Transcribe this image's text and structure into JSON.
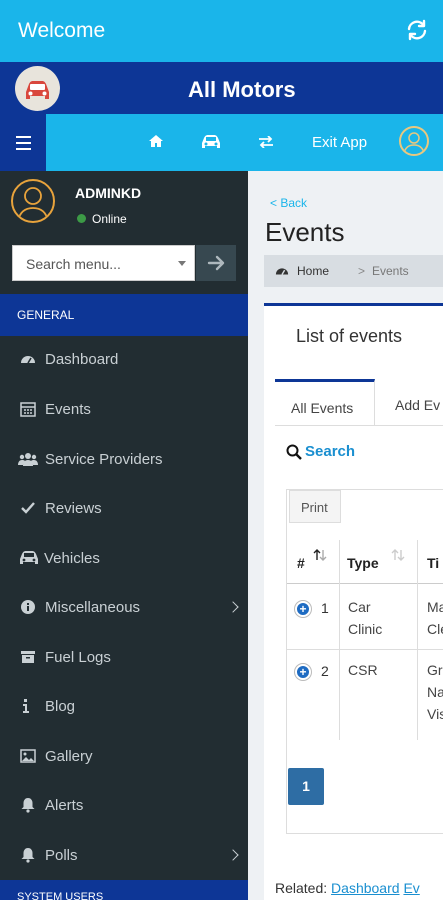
{
  "appbar": {
    "title": "Welcome",
    "refresh_icon": "refresh-icon"
  },
  "brand": {
    "name": "All Motors",
    "logo_icon": "car-logo-icon"
  },
  "topnav": {
    "items": [
      {
        "icon": "home-icon"
      },
      {
        "icon": "car-icon"
      },
      {
        "icon": "exchange-icon"
      }
    ],
    "exit_label": "Exit App",
    "avatar_icon": "user-avatar-icon"
  },
  "user": {
    "name": "ADMINKD",
    "status": "Online"
  },
  "search": {
    "placeholder": "Search menu..."
  },
  "sidebar": {
    "section_general": "GENERAL",
    "section_system": "SYSTEM USERS",
    "items": [
      {
        "label": "Dashboard",
        "icon": "dashboard-icon"
      },
      {
        "label": "Events",
        "icon": "calendar-icon"
      },
      {
        "label": "Service Providers",
        "icon": "users-icon"
      },
      {
        "label": "Reviews",
        "icon": "check-icon"
      },
      {
        "label": "Vehicles",
        "icon": "car-icon"
      },
      {
        "label": "Miscellaneous",
        "icon": "info-circle-icon",
        "has_submenu": true
      },
      {
        "label": "Fuel Logs",
        "icon": "inbox-icon"
      },
      {
        "label": "Blog",
        "icon": "info-icon"
      },
      {
        "label": "Gallery",
        "icon": "image-icon"
      },
      {
        "label": "Alerts",
        "icon": "bell-icon"
      },
      {
        "label": "Polls",
        "icon": "bell-icon",
        "has_submenu": true
      }
    ]
  },
  "main": {
    "back_label": "< Back",
    "title": "Events",
    "breadcrumb": {
      "home": "Home",
      "separator": ">",
      "current": "Events"
    },
    "card_title": "List of events",
    "tabs": [
      "All Events",
      "Add Ev"
    ],
    "search_label": "Search",
    "print_label": "Print",
    "table": {
      "headers": [
        "#",
        "Type",
        "Ti"
      ],
      "rows": [
        {
          "num": "1",
          "type_line1": "Car",
          "type_line2": "Clinic",
          "title_line1": "Ma",
          "title_line2": "Cle",
          "title_line3": ""
        },
        {
          "num": "2",
          "type_line1": "CSR",
          "type_line2": "",
          "title_line1": "Gr",
          "title_line2": "Na",
          "title_line3": "Vis"
        }
      ]
    },
    "pagination": {
      "current": "1"
    },
    "related": {
      "label": "Related:",
      "link1": "Dashboard",
      "link2": "Ev"
    }
  },
  "colors": {
    "accent": "#1ab5ea",
    "brand": "#0d3696",
    "sidebar": "#222d32",
    "link": "#1a8fd0"
  }
}
